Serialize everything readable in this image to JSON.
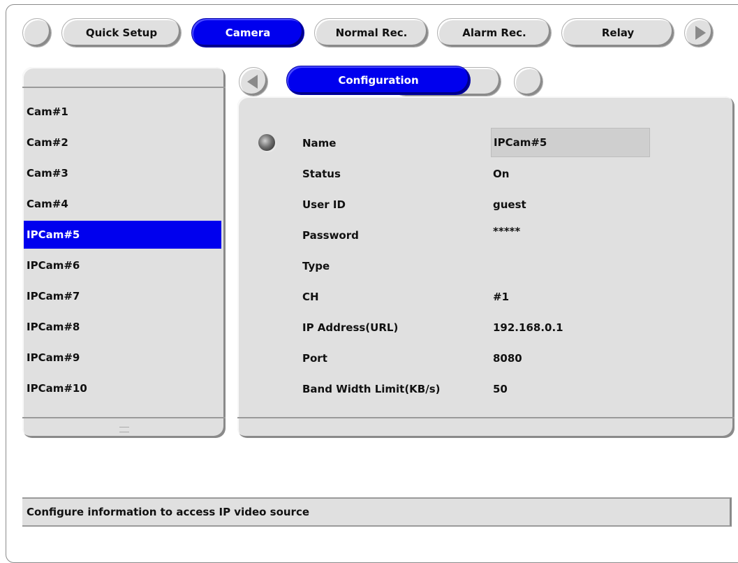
{
  "top_tabs": [
    {
      "label": "Quick Setup",
      "active": false
    },
    {
      "label": "Camera",
      "active": true
    },
    {
      "label": "Normal Rec.",
      "active": false
    },
    {
      "label": "Alarm Rec.",
      "active": false
    },
    {
      "label": "Relay",
      "active": false
    }
  ],
  "sub_tab": {
    "label": "Configuration"
  },
  "cameras": [
    "Cam#1",
    "Cam#2",
    "Cam#3",
    "Cam#4",
    "IPCam#5",
    "IPCam#6",
    "IPCam#7",
    "IPCam#8",
    "IPCam#9",
    "IPCam#10"
  ],
  "selected_camera": "IPCam#5",
  "config": {
    "name": {
      "label": "Name",
      "value": "IPCam#5"
    },
    "status": {
      "label": "Status",
      "value": "On"
    },
    "user_id": {
      "label": "User ID",
      "value": "guest"
    },
    "password": {
      "label": "Password",
      "value": "*****"
    },
    "type": {
      "label": "Type",
      "value": ""
    },
    "ch": {
      "label": "CH",
      "value": "#1"
    },
    "ip_address": {
      "label": "IP Address(URL)",
      "value": "192.168.0.1"
    },
    "port": {
      "label": "Port",
      "value": "8080"
    },
    "bandwidth": {
      "label": "Band Width Limit(KB/s)",
      "value": "50"
    }
  },
  "status_message": "Configure information to access IP video source",
  "colors": {
    "accent": "#0000ee",
    "panel": "#e0e0e0"
  }
}
